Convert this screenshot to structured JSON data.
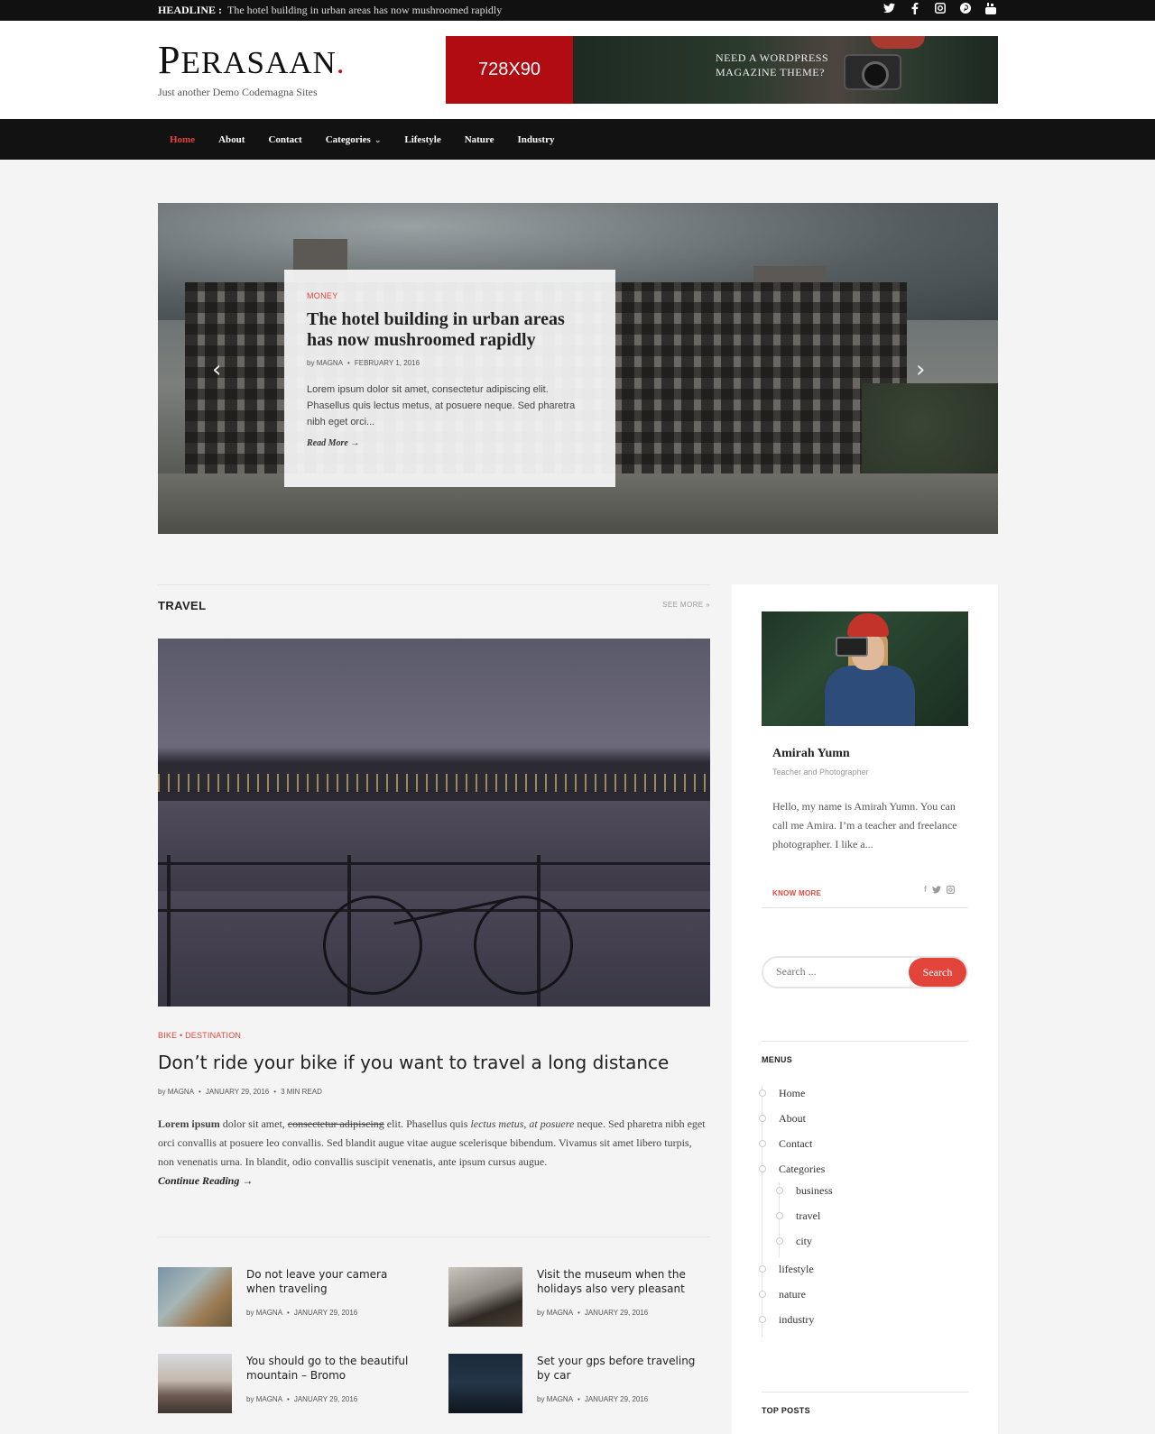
{
  "topbar": {
    "headline_label": "HEADLINE :",
    "headline_text": "The hotel building in urban areas has now mushroomed rapidly",
    "social": [
      {
        "icon": "twitter-icon",
        "glyph": "🐦"
      },
      {
        "icon": "facebook-icon",
        "glyph": "f"
      },
      {
        "icon": "instagram-icon",
        "glyph": "▣"
      },
      {
        "icon": "pinterest-icon",
        "glyph": "℗"
      },
      {
        "icon": "youtube-icon",
        "glyph": "▶"
      }
    ]
  },
  "header": {
    "logo_first": "P",
    "logo_rest": "ERASAAN",
    "logo_dot": ".",
    "tagline": "Just another Demo Codemagna Sites",
    "banner_size": "728X90",
    "banner_text_1": "NEED A WORDPRESS",
    "banner_text_2": "MAGAZINE THEME?"
  },
  "nav": {
    "items": [
      "Home",
      "About",
      "Contact",
      "Categories",
      "Lifestyle",
      "Nature",
      "Industry"
    ],
    "active": "Home"
  },
  "hero": {
    "category": "MONEY",
    "title": "The hotel building in urban areas has now mushroomed rapidly",
    "author_prefix": "by",
    "author": "MAGNA",
    "date": "FEBRUARY 1, 2016",
    "excerpt": "Lorem ipsum dolor sit amet, consectetur adipiscing elit. Phasellus quis lectus metus, at posuere neque. Sed pharetra nibh eget orci...",
    "read_more": "Read More →",
    "prev": "‹",
    "next": "›"
  },
  "travel": {
    "section_title": "TRAVEL",
    "see_more": "SEE MORE »",
    "featured": {
      "cat1": "BIKE",
      "cat_sep": " • ",
      "cat2": "DESTINATION",
      "title": "Don’t ride your bike if you want to travel a long distance",
      "author_prefix": "by",
      "author": "MAGNA",
      "date": "JANUARY 29, 2016",
      "read_time": "3 MIN READ",
      "excerpt_bold": "Lorem ipsum",
      "excerpt_1": " dolor sit amet, ",
      "excerpt_strike": "consectetur adipiscing",
      "excerpt_2": " elit. Phasellus quis ",
      "excerpt_italic": "lectus metus, at posuere",
      "excerpt_3": " neque. Sed pharetra nibh eget orci convallis at posuere leo convallis. Sed blandit augue vitae augue scelerisque bibendum. Vivamus sit amet libero turpis, non venenatis urna. In blandit, odio convallis suscipit venenatis, ante ipsum cursus augue.",
      "continue": "Continue Reading →"
    },
    "posts": [
      {
        "title": "Do not leave your camera when traveling",
        "author_prefix": "by",
        "author": "MAGNA",
        "date": "JANUARY 29, 2016"
      },
      {
        "title": "Visit the museum when the holidays also very pleasant",
        "author_prefix": "by",
        "author": "MAGNA",
        "date": "JANUARY 29, 2016"
      },
      {
        "title": "You should go to the beautiful mountain – Bromo",
        "author_prefix": "by",
        "author": "MAGNA",
        "date": "JANUARY 29, 2016"
      },
      {
        "title": "Set your gps before traveling by car",
        "author_prefix": "by",
        "author": "MAGNA",
        "date": "JANUARY 29, 2016"
      }
    ]
  },
  "sidebar": {
    "author_name": "Amirah Yumn",
    "author_role": "Teacher and Photographer",
    "author_bio": "Hello, my name is Amirah Yumn. You can call me Amira. I’m a teacher and freelance photographer. I like a...",
    "know_more": "KNOW MORE",
    "author_social": [
      "f",
      "🐦",
      "▣"
    ],
    "search_placeholder": "Search ...",
    "search_button": "Search",
    "menus_title": "MENUS",
    "menu": [
      "Home",
      "About",
      "Contact",
      "Categories"
    ],
    "submenu": [
      "business",
      "travel",
      "city"
    ],
    "menu_after": [
      "lifestyle",
      "nature",
      "industry"
    ],
    "top_posts_title": "TOP POSTS"
  },
  "colors": {
    "accent": "#e2443a",
    "topbar": "#111111",
    "banner_red": "#b00c12"
  }
}
